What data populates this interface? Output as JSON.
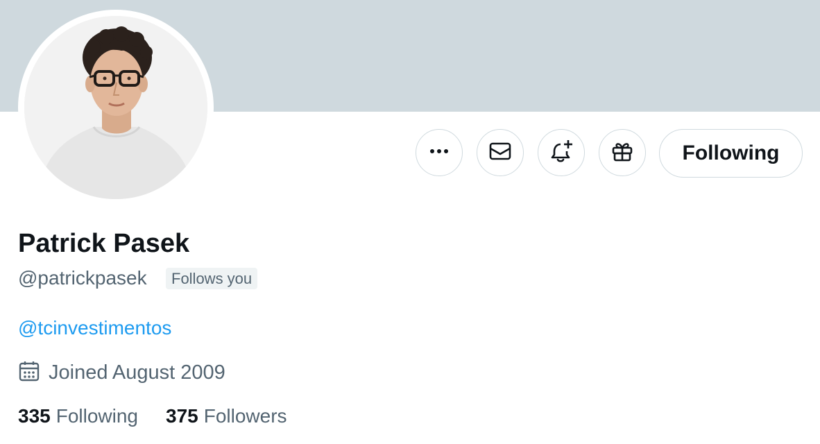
{
  "profile": {
    "name": "Patrick Pasek",
    "handle": "@patrickpasek",
    "follows_you_badge": "Follows you",
    "bio_link": "@tcinvestimentos",
    "joined": "Joined August 2009",
    "banner_color": "#cfd9de"
  },
  "actions": {
    "more_icon": "ellipsis-icon",
    "message_icon": "envelope-icon",
    "notify_icon": "bell-plus-icon",
    "gift_icon": "gift-icon",
    "follow_label": "Following"
  },
  "stats": {
    "following_count": "335",
    "following_label": "Following",
    "followers_count": "375",
    "followers_label": "Followers"
  },
  "colors": {
    "text_primary": "#0f1419",
    "text_secondary": "#536471",
    "link": "#1d9bf0",
    "border": "#cfd9de"
  }
}
